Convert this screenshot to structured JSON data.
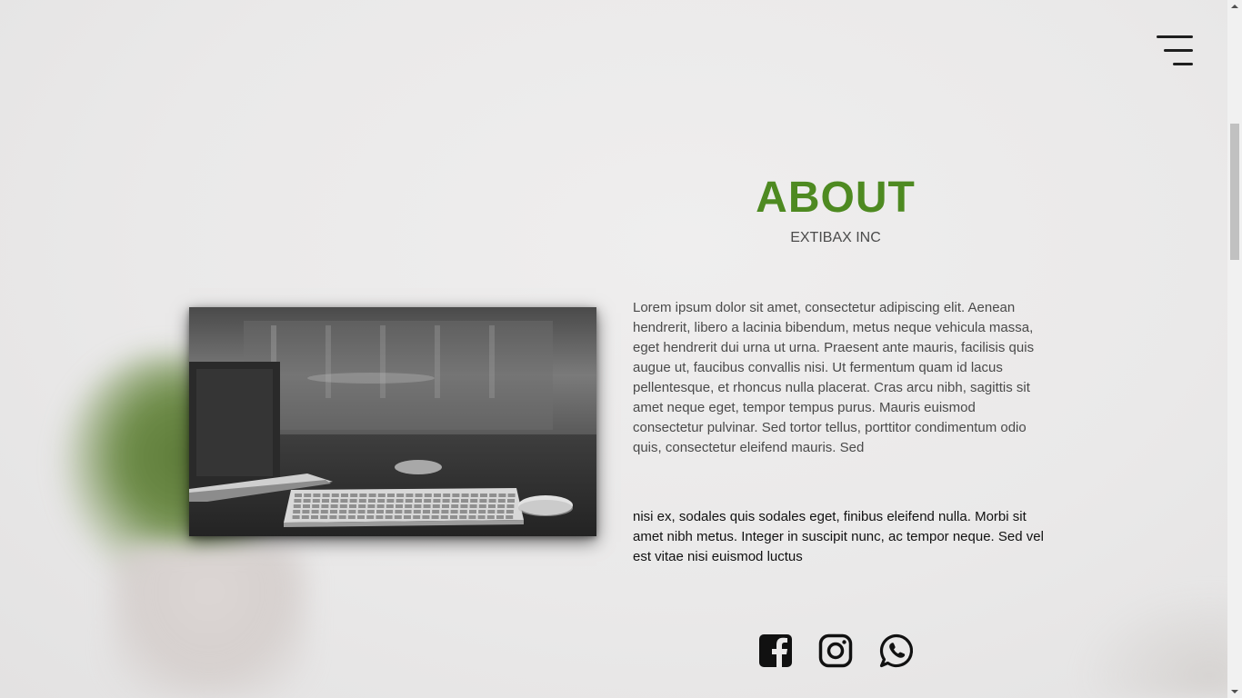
{
  "header": {
    "menu_icon": "hamburger-menu-icon"
  },
  "about": {
    "title": "ABOUT",
    "subtitle": "EXTIBAX INC",
    "paragraph": "Lorem ipsum dolor sit amet, consectetur adipiscing elit. Aenean hendrerit, libero a lacinia bibendum, metus neque vehicula massa, eget hendrerit dui urna ut urna. Praesent ante mauris, facilisis quis augue ut, faucibus convallis nisi. Ut fermentum quam id lacus pellentesque, et rhoncus nulla placerat. Cras arcu nibh, sagittis sit amet neque eget, tempor tempus purus. Mauris euismod consectetur pulvinar. Sed tortor tellus, porttitor condimentum odio quis, consectetur eleifend mauris. Sed",
    "highlight": "nisi ex, sodales quis sodales eget, finibus eleifend nulla. Morbi sit amet nibh metus. Integer in suscipit nunc, ac tempor neque. Sed vel est vitae nisi euismod luctus",
    "image": "desk-keyboard-laptop-photo"
  },
  "social": [
    {
      "icon": "facebook-icon"
    },
    {
      "icon": "instagram-icon"
    },
    {
      "icon": "whatsapp-icon"
    }
  ],
  "colors": {
    "accent": "#4e8a21",
    "background": "#ebeaea",
    "icon": "#111111"
  }
}
